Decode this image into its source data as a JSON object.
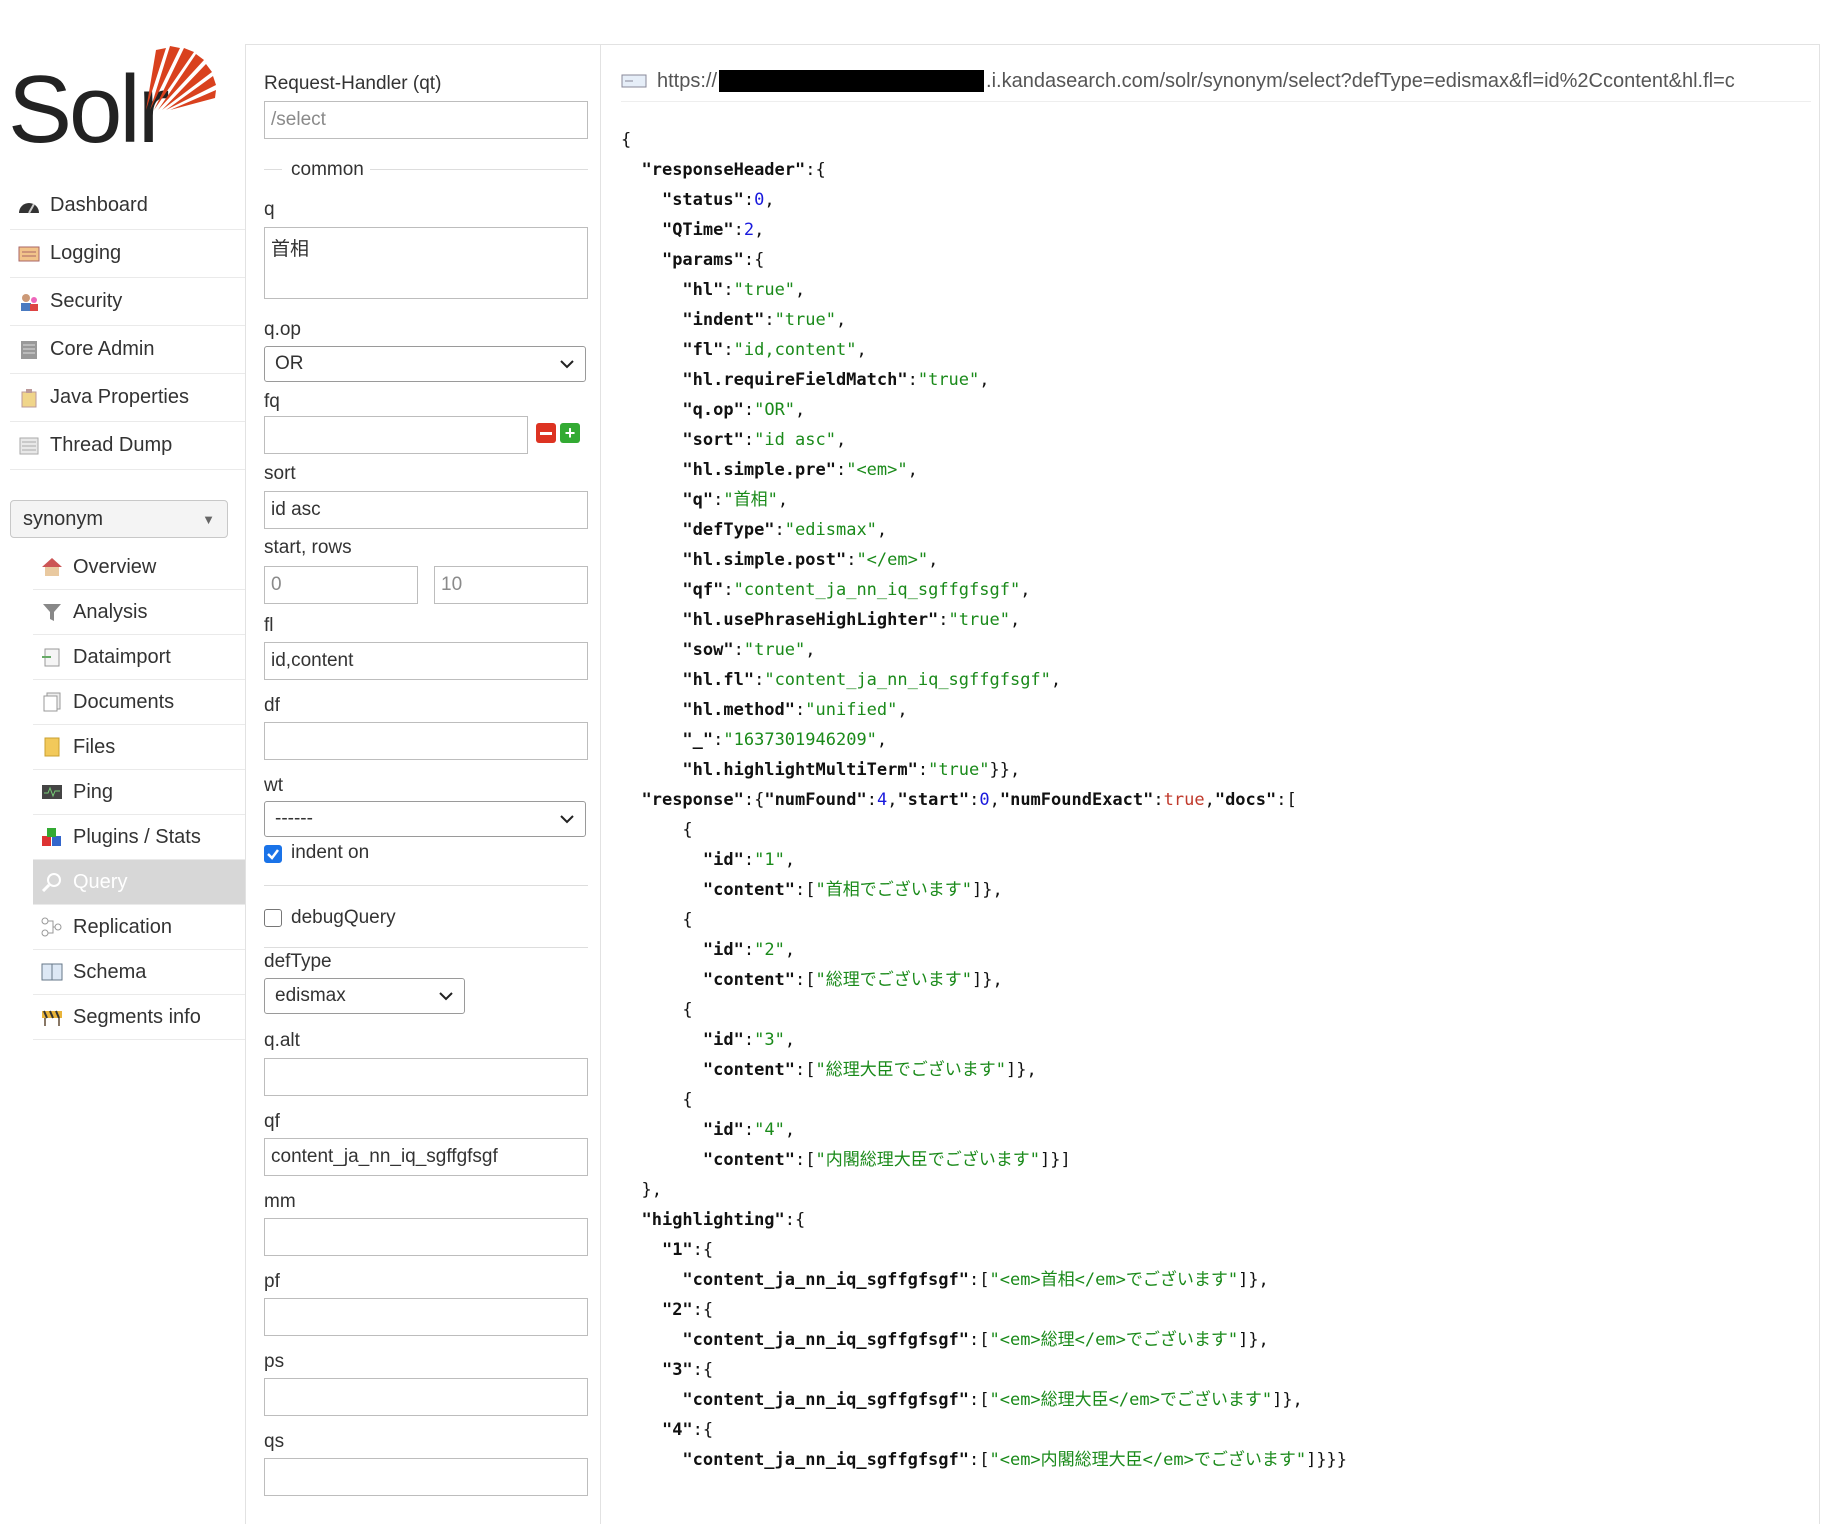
{
  "app": {
    "logo_text": "Solr"
  },
  "sidebar": {
    "main": [
      {
        "label": "Dashboard",
        "icon": "dashboard-icon"
      },
      {
        "label": "Logging",
        "icon": "logging-icon"
      },
      {
        "label": "Security",
        "icon": "security-icon"
      },
      {
        "label": "Core Admin",
        "icon": "core-admin-icon"
      },
      {
        "label": "Java Properties",
        "icon": "java-properties-icon"
      },
      {
        "label": "Thread Dump",
        "icon": "thread-dump-icon"
      }
    ],
    "core_selector": {
      "value": "synonym"
    },
    "core": [
      {
        "label": "Overview",
        "icon": "overview-icon"
      },
      {
        "label": "Analysis",
        "icon": "analysis-icon"
      },
      {
        "label": "Dataimport",
        "icon": "dataimport-icon"
      },
      {
        "label": "Documents",
        "icon": "documents-icon"
      },
      {
        "label": "Files",
        "icon": "files-icon"
      },
      {
        "label": "Ping",
        "icon": "ping-icon"
      },
      {
        "label": "Plugins / Stats",
        "icon": "plugins-icon"
      },
      {
        "label": "Query",
        "icon": "query-icon",
        "active": true
      },
      {
        "label": "Replication",
        "icon": "replication-icon"
      },
      {
        "label": "Schema",
        "icon": "schema-icon"
      },
      {
        "label": "Segments info",
        "icon": "segments-icon"
      }
    ]
  },
  "form": {
    "qt": {
      "label": "Request-Handler (qt)",
      "placeholder": "/select"
    },
    "common_legend": "common",
    "q": {
      "label": "q",
      "value": "首相"
    },
    "qop": {
      "label": "q.op",
      "value": "OR"
    },
    "fq": {
      "label": "fq",
      "value": ""
    },
    "sort": {
      "label": "sort",
      "value": "id asc"
    },
    "start_rows": {
      "label": "start, rows",
      "start_placeholder": "0",
      "rows_placeholder": "10"
    },
    "fl": {
      "label": "fl",
      "value": "id,content"
    },
    "df": {
      "label": "df",
      "value": ""
    },
    "wt": {
      "label": "wt",
      "value": "------"
    },
    "indent": {
      "label": "indent on",
      "checked": true
    },
    "debugQuery": {
      "label": "debugQuery",
      "checked": false
    },
    "defType": {
      "label": "defType",
      "value": "edismax"
    },
    "qalt": {
      "label": "q.alt",
      "value": ""
    },
    "qf": {
      "label": "qf",
      "value": "content_ja_nn_iq_sgffgfsgf"
    },
    "mm": {
      "label": "mm",
      "value": ""
    },
    "pf": {
      "label": "pf",
      "value": ""
    },
    "ps": {
      "label": "ps",
      "value": ""
    },
    "qs": {
      "label": "qs",
      "value": ""
    }
  },
  "result": {
    "url_prefix": "https://",
    "url_suffix": ".i.kandasearch.com/solr/synonym/select?defType=edismax&fl=id%2Ccontent&hl.fl=c",
    "json_lines": [
      {
        "i": 0,
        "t": [
          [
            "p",
            "{"
          ]
        ]
      },
      {
        "i": 1,
        "t": [
          [
            "k",
            "\"responseHeader\""
          ],
          [
            "p",
            ":{"
          ]
        ]
      },
      {
        "i": 2,
        "t": [
          [
            "k",
            "\"status\""
          ],
          [
            "p",
            ":"
          ],
          [
            "n",
            "0"
          ],
          [
            "p",
            ","
          ]
        ]
      },
      {
        "i": 2,
        "t": [
          [
            "k",
            "\"QTime\""
          ],
          [
            "p",
            ":"
          ],
          [
            "n",
            "2"
          ],
          [
            "p",
            ","
          ]
        ]
      },
      {
        "i": 2,
        "t": [
          [
            "k",
            "\"params\""
          ],
          [
            "p",
            ":{"
          ]
        ]
      },
      {
        "i": 3,
        "t": [
          [
            "k",
            "\"hl\""
          ],
          [
            "p",
            ":"
          ],
          [
            "s",
            "\"true\""
          ],
          [
            "p",
            ","
          ]
        ]
      },
      {
        "i": 3,
        "t": [
          [
            "k",
            "\"indent\""
          ],
          [
            "p",
            ":"
          ],
          [
            "s",
            "\"true\""
          ],
          [
            "p",
            ","
          ]
        ]
      },
      {
        "i": 3,
        "t": [
          [
            "k",
            "\"fl\""
          ],
          [
            "p",
            ":"
          ],
          [
            "s",
            "\"id,content\""
          ],
          [
            "p",
            ","
          ]
        ]
      },
      {
        "i": 3,
        "t": [
          [
            "k",
            "\"hl.requireFieldMatch\""
          ],
          [
            "p",
            ":"
          ],
          [
            "s",
            "\"true\""
          ],
          [
            "p",
            ","
          ]
        ]
      },
      {
        "i": 3,
        "t": [
          [
            "k",
            "\"q.op\""
          ],
          [
            "p",
            ":"
          ],
          [
            "s",
            "\"OR\""
          ],
          [
            "p",
            ","
          ]
        ]
      },
      {
        "i": 3,
        "t": [
          [
            "k",
            "\"sort\""
          ],
          [
            "p",
            ":"
          ],
          [
            "s",
            "\"id asc\""
          ],
          [
            "p",
            ","
          ]
        ]
      },
      {
        "i": 3,
        "t": [
          [
            "k",
            "\"hl.simple.pre\""
          ],
          [
            "p",
            ":"
          ],
          [
            "s",
            "\"<em>\""
          ],
          [
            "p",
            ","
          ]
        ]
      },
      {
        "i": 3,
        "t": [
          [
            "k",
            "\"q\""
          ],
          [
            "p",
            ":"
          ],
          [
            "s",
            "\"首相\""
          ],
          [
            "p",
            ","
          ]
        ]
      },
      {
        "i": 3,
        "t": [
          [
            "k",
            "\"defType\""
          ],
          [
            "p",
            ":"
          ],
          [
            "s",
            "\"edismax\""
          ],
          [
            "p",
            ","
          ]
        ]
      },
      {
        "i": 3,
        "t": [
          [
            "k",
            "\"hl.simple.post\""
          ],
          [
            "p",
            ":"
          ],
          [
            "s",
            "\"</em>\""
          ],
          [
            "p",
            ","
          ]
        ]
      },
      {
        "i": 3,
        "t": [
          [
            "k",
            "\"qf\""
          ],
          [
            "p",
            ":"
          ],
          [
            "s",
            "\"content_ja_nn_iq_sgffgfsgf\""
          ],
          [
            "p",
            ","
          ]
        ]
      },
      {
        "i": 3,
        "t": [
          [
            "k",
            "\"hl.usePhraseHighLighter\""
          ],
          [
            "p",
            ":"
          ],
          [
            "s",
            "\"true\""
          ],
          [
            "p",
            ","
          ]
        ]
      },
      {
        "i": 3,
        "t": [
          [
            "k",
            "\"sow\""
          ],
          [
            "p",
            ":"
          ],
          [
            "s",
            "\"true\""
          ],
          [
            "p",
            ","
          ]
        ]
      },
      {
        "i": 3,
        "t": [
          [
            "k",
            "\"hl.fl\""
          ],
          [
            "p",
            ":"
          ],
          [
            "s",
            "\"content_ja_nn_iq_sgffgfsgf\""
          ],
          [
            "p",
            ","
          ]
        ]
      },
      {
        "i": 3,
        "t": [
          [
            "k",
            "\"hl.method\""
          ],
          [
            "p",
            ":"
          ],
          [
            "s",
            "\"unified\""
          ],
          [
            "p",
            ","
          ]
        ]
      },
      {
        "i": 3,
        "t": [
          [
            "k",
            "\"_\""
          ],
          [
            "p",
            ":"
          ],
          [
            "s",
            "\"1637301946209\""
          ],
          [
            "p",
            ","
          ]
        ]
      },
      {
        "i": 3,
        "t": [
          [
            "k",
            "\"hl.highlightMultiTerm\""
          ],
          [
            "p",
            ":"
          ],
          [
            "s",
            "\"true\""
          ],
          [
            "p",
            "}},"
          ]
        ]
      },
      {
        "i": 1,
        "t": [
          [
            "k",
            "\"response\""
          ],
          [
            "p",
            ":{"
          ],
          [
            "k",
            "\"numFound\""
          ],
          [
            "p",
            ":"
          ],
          [
            "n",
            "4"
          ],
          [
            "p",
            ","
          ],
          [
            "k",
            "\"start\""
          ],
          [
            "p",
            ":"
          ],
          [
            "n",
            "0"
          ],
          [
            "p",
            ","
          ],
          [
            "k",
            "\"numFoundExact\""
          ],
          [
            "p",
            ":"
          ],
          [
            "b",
            "true"
          ],
          [
            "p",
            ","
          ],
          [
            "k",
            "\"docs\""
          ],
          [
            "p",
            ":["
          ]
        ]
      },
      {
        "i": 3,
        "t": [
          [
            "p",
            "{"
          ]
        ]
      },
      {
        "i": 4,
        "t": [
          [
            "k",
            "\"id\""
          ],
          [
            "p",
            ":"
          ],
          [
            "s",
            "\"1\""
          ],
          [
            "p",
            ","
          ]
        ]
      },
      {
        "i": 4,
        "t": [
          [
            "k",
            "\"content\""
          ],
          [
            "p",
            ":["
          ],
          [
            "s",
            "\"首相でございます\""
          ],
          [
            "p",
            "]},"
          ]
        ]
      },
      {
        "i": 3,
        "t": [
          [
            "p",
            "{"
          ]
        ]
      },
      {
        "i": 4,
        "t": [
          [
            "k",
            "\"id\""
          ],
          [
            "p",
            ":"
          ],
          [
            "s",
            "\"2\""
          ],
          [
            "p",
            ","
          ]
        ]
      },
      {
        "i": 4,
        "t": [
          [
            "k",
            "\"content\""
          ],
          [
            "p",
            ":["
          ],
          [
            "s",
            "\"総理でございます\""
          ],
          [
            "p",
            "]},"
          ]
        ]
      },
      {
        "i": 3,
        "t": [
          [
            "p",
            "{"
          ]
        ]
      },
      {
        "i": 4,
        "t": [
          [
            "k",
            "\"id\""
          ],
          [
            "p",
            ":"
          ],
          [
            "s",
            "\"3\""
          ],
          [
            "p",
            ","
          ]
        ]
      },
      {
        "i": 4,
        "t": [
          [
            "k",
            "\"content\""
          ],
          [
            "p",
            ":["
          ],
          [
            "s",
            "\"総理大臣でございます\""
          ],
          [
            "p",
            "]},"
          ]
        ]
      },
      {
        "i": 3,
        "t": [
          [
            "p",
            "{"
          ]
        ]
      },
      {
        "i": 4,
        "t": [
          [
            "k",
            "\"id\""
          ],
          [
            "p",
            ":"
          ],
          [
            "s",
            "\"4\""
          ],
          [
            "p",
            ","
          ]
        ]
      },
      {
        "i": 4,
        "t": [
          [
            "k",
            "\"content\""
          ],
          [
            "p",
            ":["
          ],
          [
            "s",
            "\"内閣総理大臣でございます\""
          ],
          [
            "p",
            "]}]"
          ]
        ]
      },
      {
        "i": 1,
        "t": [
          [
            "p",
            "},"
          ]
        ]
      },
      {
        "i": 1,
        "t": [
          [
            "k",
            "\"highlighting\""
          ],
          [
            "p",
            ":{"
          ]
        ]
      },
      {
        "i": 2,
        "t": [
          [
            "k",
            "\"1\""
          ],
          [
            "p",
            ":{"
          ]
        ]
      },
      {
        "i": 3,
        "t": [
          [
            "k",
            "\"content_ja_nn_iq_sgffgfsgf\""
          ],
          [
            "p",
            ":["
          ],
          [
            "s",
            "\"<em>首相</em>でございます\""
          ],
          [
            "p",
            "]},"
          ]
        ]
      },
      {
        "i": 2,
        "t": [
          [
            "k",
            "\"2\""
          ],
          [
            "p",
            ":{"
          ]
        ]
      },
      {
        "i": 3,
        "t": [
          [
            "k",
            "\"content_ja_nn_iq_sgffgfsgf\""
          ],
          [
            "p",
            ":["
          ],
          [
            "s",
            "\"<em>総理</em>でございます\""
          ],
          [
            "p",
            "]},"
          ]
        ]
      },
      {
        "i": 2,
        "t": [
          [
            "k",
            "\"3\""
          ],
          [
            "p",
            ":{"
          ]
        ]
      },
      {
        "i": 3,
        "t": [
          [
            "k",
            "\"content_ja_nn_iq_sgffgfsgf\""
          ],
          [
            "p",
            ":["
          ],
          [
            "s",
            "\"<em>総理大臣</em>でございます\""
          ],
          [
            "p",
            "]},"
          ]
        ]
      },
      {
        "i": 2,
        "t": [
          [
            "k",
            "\"4\""
          ],
          [
            "p",
            ":{"
          ]
        ]
      },
      {
        "i": 3,
        "t": [
          [
            "k",
            "\"content_ja_nn_iq_sgffgfsgf\""
          ],
          [
            "p",
            ":["
          ],
          [
            "s",
            "\"<em>内閣総理大臣</em>でございます\""
          ],
          [
            "p",
            "]}}}"
          ]
        ]
      }
    ]
  },
  "colors": {
    "brand_red": "#d9411e",
    "json_string": "#1a8a1a",
    "json_number": "#1a1add",
    "json_bool": "#c0392b"
  }
}
